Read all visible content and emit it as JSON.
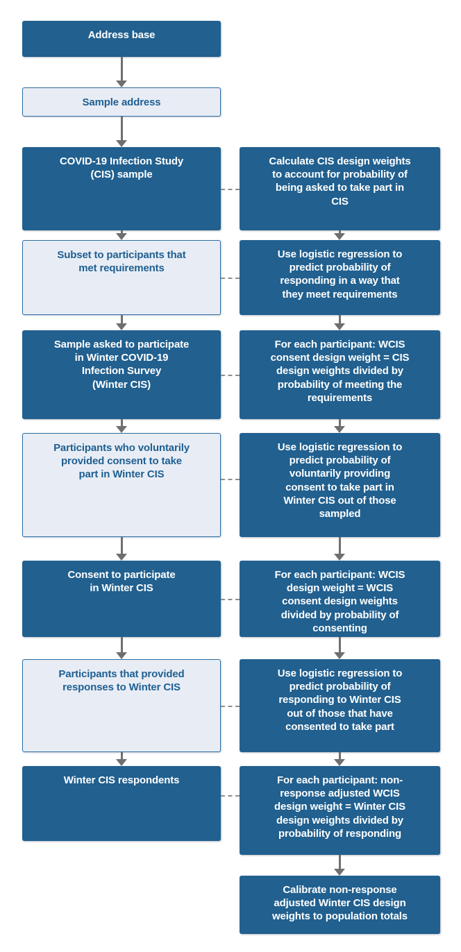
{
  "diagram": {
    "title": "Winter COVID-19 Infection Survey weighting flowchart",
    "colors": {
      "filled_bg": "#21608f",
      "filled_text": "#ffffff",
      "outline_bg": "#e8edf5",
      "outline_border": "#2b6ca3",
      "outline_text": "#1f5f91",
      "arrow": "#6f6f6f",
      "dash": "#8d8d8d",
      "page_bg": "#ffffff"
    },
    "left_column": [
      {
        "id": "address-base",
        "label": "Address base",
        "style": "filled"
      },
      {
        "id": "sample-address",
        "label": "Sample address",
        "style": "outline"
      },
      {
        "id": "cis-sample",
        "label": "COVID-19 Infection Study\n(CIS) sample",
        "style": "filled"
      },
      {
        "id": "subset-met-requirements",
        "label": "Subset to participants that\nmet requirements",
        "style": "outline"
      },
      {
        "id": "sample-asked-participate",
        "label": "Sample asked to participate\nin Winter COVID-19\nInfection Survey\n(Winter CIS)",
        "style": "filled"
      },
      {
        "id": "participants-voluntary-consent",
        "label": "Participants who voluntarily\nprovided consent to take\npart in Winter CIS",
        "style": "outline"
      },
      {
        "id": "consent-to-participate",
        "label": "Consent to participate\nin Winter CIS",
        "style": "filled"
      },
      {
        "id": "participants-provided-responses",
        "label": "Participants that provided\nresponses to Winter CIS",
        "style": "outline"
      },
      {
        "id": "winter-cis-respondents",
        "label": "Winter CIS respondents",
        "style": "filled"
      }
    ],
    "right_column": [
      {
        "id": "calculate-cis-design-weights",
        "label": "Calculate CIS design weights\nto account for probability of\nbeing asked to take part in\nCIS",
        "style": "filled"
      },
      {
        "id": "logistic-regression-requirements",
        "label": "Use logistic regression to\npredict probability of\nresponding in a way that\nthey meet requirements",
        "style": "filled"
      },
      {
        "id": "wcis-consent-design-weight",
        "label": "For each participant: WCIS\nconsent design weight = CIS\ndesign weights divided by\nprobability of meeting the\nrequirements",
        "style": "filled"
      },
      {
        "id": "logistic-regression-consent",
        "label": "Use logistic regression to\npredict probability of\nvoluntarily providing\nconsent to take part in\nWinter CIS out of those\nsampled",
        "style": "filled"
      },
      {
        "id": "wcis-design-weight",
        "label": "For each participant: WCIS\ndesign weight = WCIS\nconsent design weights\ndivided by probability of\nconsenting",
        "style": "filled"
      },
      {
        "id": "logistic-regression-responding",
        "label": "Use logistic regression to\npredict probability of\nresponding to Winter CIS\nout of those that have\nconsented to take part",
        "style": "filled"
      },
      {
        "id": "nonresponse-adjusted-weight",
        "label": "For each participant: non-\nresponse adjusted WCIS\ndesign weight = Winter CIS\ndesign weights divided by\nprobability of responding",
        "style": "filled"
      },
      {
        "id": "calibrate-population-totals",
        "label": "Calibrate non-response\nadjusted Winter CIS design\nweights to population totals",
        "style": "filled"
      }
    ]
  }
}
